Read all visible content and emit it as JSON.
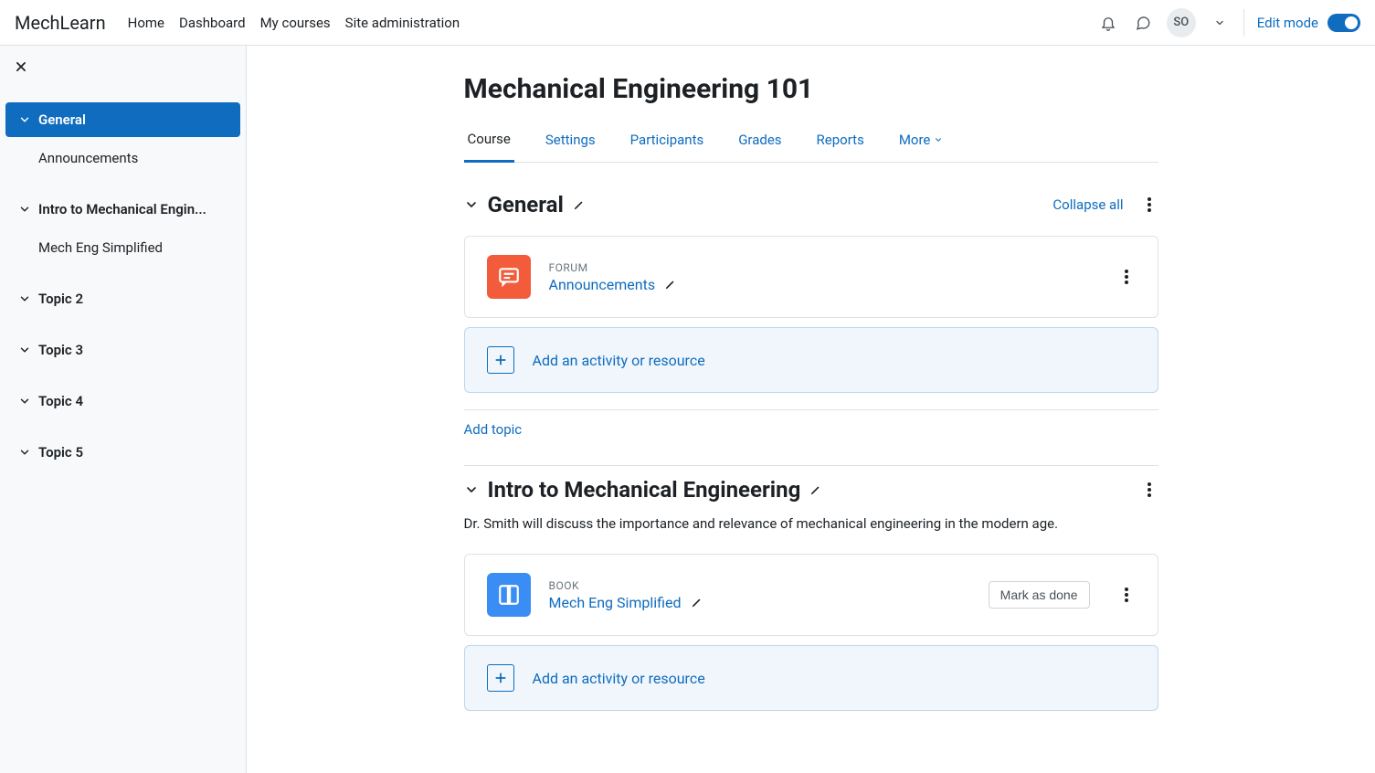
{
  "brand": "MechLearn",
  "nav": {
    "home": "Home",
    "dashboard": "Dashboard",
    "mycourses": "My courses",
    "siteadmin": "Site administration"
  },
  "user": {
    "initials": "SO"
  },
  "editmode": {
    "label": "Edit mode"
  },
  "sidebar": {
    "items": [
      {
        "label": "General",
        "active": true,
        "children": [
          {
            "label": "Announcements"
          }
        ]
      },
      {
        "label": "Intro to Mechanical Engin...",
        "children": [
          {
            "label": "Mech Eng Simplified"
          }
        ]
      },
      {
        "label": "Topic 2"
      },
      {
        "label": "Topic 3"
      },
      {
        "label": "Topic 4"
      },
      {
        "label": "Topic 5"
      }
    ]
  },
  "course": {
    "title": "Mechanical Engineering 101",
    "tabs": {
      "course": "Course",
      "settings": "Settings",
      "participants": "Participants",
      "grades": "Grades",
      "reports": "Reports",
      "more": "More"
    },
    "collapse_all": "Collapse all",
    "add_activity": "Add an activity or resource",
    "add_topic": "Add topic",
    "mark_done": "Mark as done",
    "sections": [
      {
        "title": "General",
        "activities": [
          {
            "type": "FORUM",
            "name": "Announcements",
            "icon": "forum"
          }
        ]
      },
      {
        "title": "Intro to Mechanical Engineering",
        "desc": "Dr. Smith will discuss the importance and relevance of mechanical engineering in the modern age.",
        "activities": [
          {
            "type": "BOOK",
            "name": "Mech Eng Simplified",
            "icon": "book",
            "completion": true
          }
        ]
      }
    ]
  }
}
